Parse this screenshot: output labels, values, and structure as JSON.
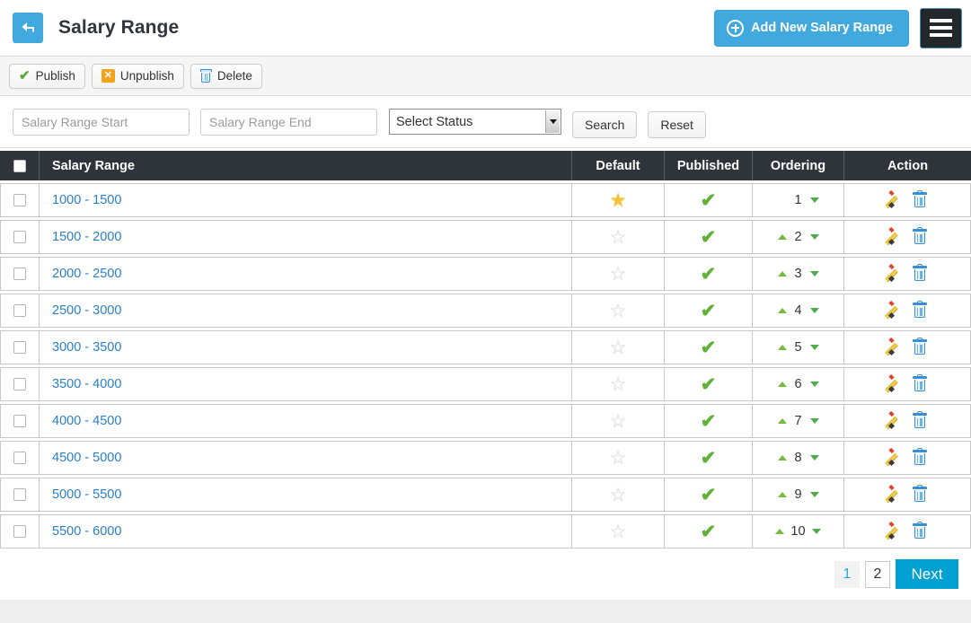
{
  "header": {
    "back_icon": "back-arrow-icon",
    "title": "Salary Range",
    "add_button_label": "Add New Salary Range",
    "menu_icon": "hamburger-menu-icon",
    "accent_color": "#41a9dd",
    "menu_bg_color": "#22272b"
  },
  "toolbar": {
    "publish_label": "Publish",
    "unpublish_label": "Unpublish",
    "delete_label": "Delete"
  },
  "filters": {
    "start_placeholder": "Salary Range Start",
    "start_value": "",
    "end_placeholder": "Salary Range End",
    "end_value": "",
    "status_selected": "Select Status",
    "status_options": [
      "Select Status"
    ],
    "search_label": "Search",
    "reset_label": "Reset"
  },
  "table": {
    "columns": {
      "select_all": "",
      "name": "Salary Range",
      "default": "Default",
      "published": "Published",
      "ordering": "Ordering",
      "action": "Action"
    },
    "rows": [
      {
        "range": "1000 - 1500",
        "is_default": true,
        "published": true,
        "order": "1",
        "can_move_up": false,
        "can_move_down": true
      },
      {
        "range": "1500 - 2000",
        "is_default": false,
        "published": true,
        "order": "2",
        "can_move_up": true,
        "can_move_down": true
      },
      {
        "range": "2000 - 2500",
        "is_default": false,
        "published": true,
        "order": "3",
        "can_move_up": true,
        "can_move_down": true
      },
      {
        "range": "2500 - 3000",
        "is_default": false,
        "published": true,
        "order": "4",
        "can_move_up": true,
        "can_move_down": true
      },
      {
        "range": "3000 - 3500",
        "is_default": false,
        "published": true,
        "order": "5",
        "can_move_up": true,
        "can_move_down": true
      },
      {
        "range": "3500 - 4000",
        "is_default": false,
        "published": true,
        "order": "6",
        "can_move_up": true,
        "can_move_down": true
      },
      {
        "range": "4000 - 4500",
        "is_default": false,
        "published": true,
        "order": "7",
        "can_move_up": true,
        "can_move_down": true
      },
      {
        "range": "4500 - 5000",
        "is_default": false,
        "published": true,
        "order": "8",
        "can_move_up": true,
        "can_move_down": true
      },
      {
        "range": "5000 - 5500",
        "is_default": false,
        "published": true,
        "order": "9",
        "can_move_up": true,
        "can_move_down": true
      },
      {
        "range": "5500 - 6000",
        "is_default": false,
        "published": true,
        "order": "10",
        "can_move_up": true,
        "can_move_down": true
      }
    ],
    "star_on_color": "#f3c336",
    "star_off_color": "#e2e2e2",
    "tick_color": "#5fb236",
    "link_color": "#2a7fc9"
  },
  "pagination": {
    "pages": [
      {
        "label": "1",
        "current": true
      },
      {
        "label": "2",
        "current": false
      }
    ],
    "next_label": "Next",
    "next_color": "#00a0d2"
  }
}
